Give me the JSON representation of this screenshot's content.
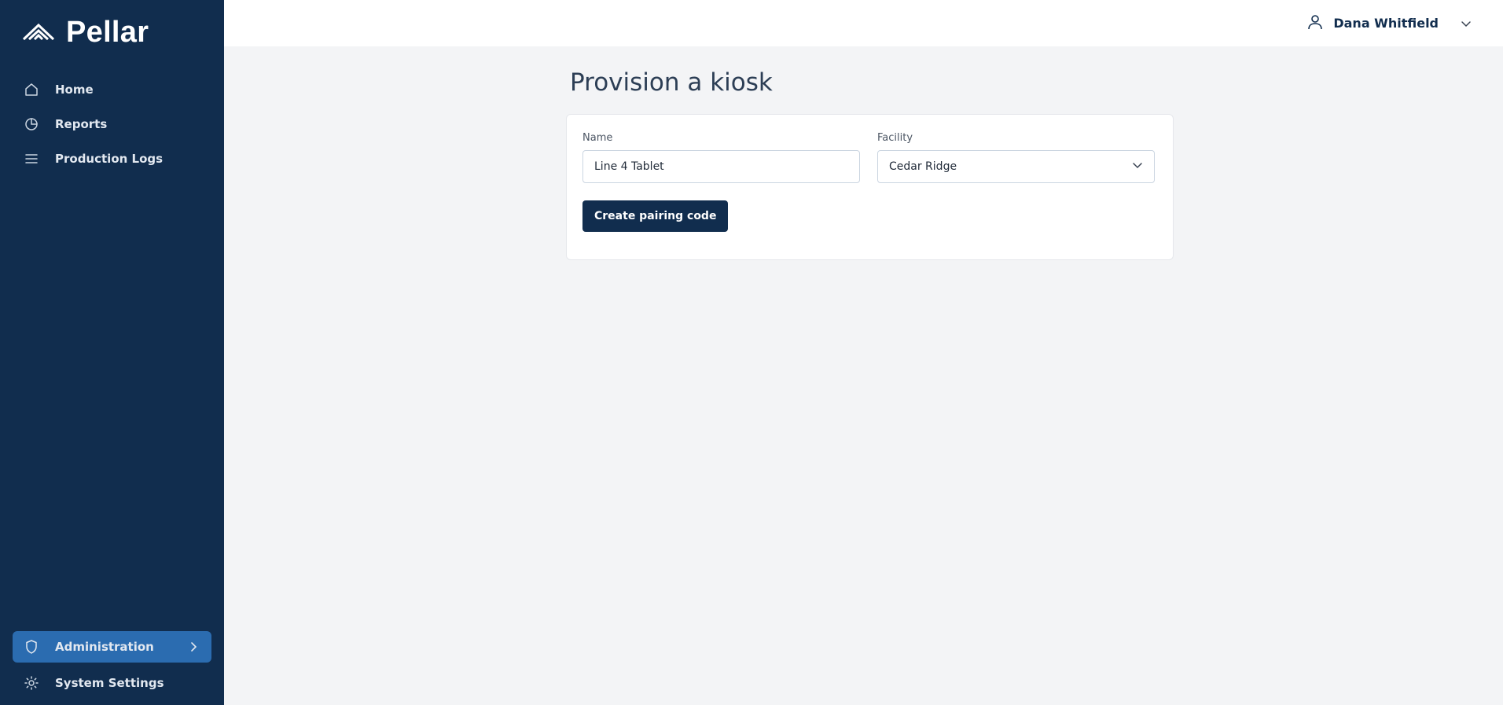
{
  "brand": {
    "name": "Pellar",
    "logo_icon": "pellar-logo-icon"
  },
  "sidebar": {
    "items": [
      {
        "label": "Home",
        "icon": "home-icon"
      },
      {
        "label": "Reports",
        "icon": "pie-chart-icon"
      },
      {
        "label": "Production Logs",
        "icon": "list-icon"
      }
    ],
    "bottom_items": [
      {
        "label": "Administration",
        "icon": "shield-icon",
        "active": true
      },
      {
        "label": "System Settings",
        "icon": "gear-icon"
      }
    ]
  },
  "header": {
    "user_name": "Dana Whitfield",
    "user_icon": "user-icon"
  },
  "page": {
    "title": "Provision a kiosk",
    "form": {
      "name_label": "Name",
      "name_value": "Line 4 Tablet",
      "facility_label": "Facility",
      "facility_value": "Cedar Ridge",
      "submit_label": "Create pairing code"
    }
  },
  "colors": {
    "sidebar_bg": "#112d4e",
    "active_item_bg": "#2b6cb0",
    "page_bg": "#f3f4f6",
    "primary_button": "#112d4e"
  }
}
